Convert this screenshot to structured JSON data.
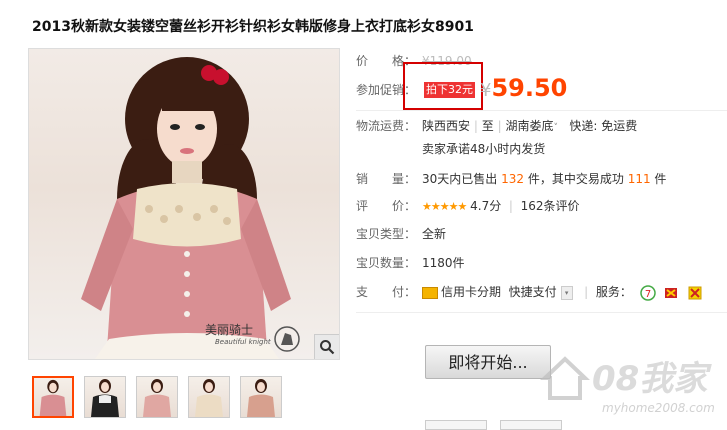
{
  "title": "2013秋新款女装镂空蕾丝衫开衫针织衫女韩版修身上衣打底衫女8901",
  "gallery": {
    "logo_text": "美丽骑士",
    "logo_subtext": "Beautiful knight",
    "thumbnail_count": 5
  },
  "price": {
    "label": "价　　格：",
    "original": "¥119.00"
  },
  "promo": {
    "label": "参加促销：",
    "tag": "拍下32元",
    "currency": "¥",
    "price": "59.50"
  },
  "shipping": {
    "label": "物流运费：",
    "from": "陕西西安",
    "sep": "至",
    "to": "湖南娄底",
    "fee": "快递: 免运费",
    "promise": "卖家承诺48小时内发货"
  },
  "sales": {
    "label": "销　　量：",
    "prefix": "30天内已售出",
    "sold": "132",
    "mid": "件，其中交易成功",
    "success": "111",
    "suffix": "件"
  },
  "rating": {
    "label": "评　　价：",
    "stars": "★★★★★",
    "score": "4.7分",
    "divider": "|",
    "reviews": "162条评价"
  },
  "type": {
    "label": "宝贝类型：",
    "value": "全新"
  },
  "quantity": {
    "label": "宝贝数量：",
    "value": "1180件"
  },
  "payment": {
    "label": "支　　付：",
    "option1": "信用卡分期",
    "option2": "快捷支付",
    "service_label": "服务："
  },
  "cta": {
    "label": "即将开始..."
  },
  "site_watermark": {
    "main": "08我家",
    "sub": "myhome2008.com"
  },
  "colors": {
    "accent": "#ff4400",
    "promo_box": "#d40000",
    "star": "#ff9900"
  }
}
